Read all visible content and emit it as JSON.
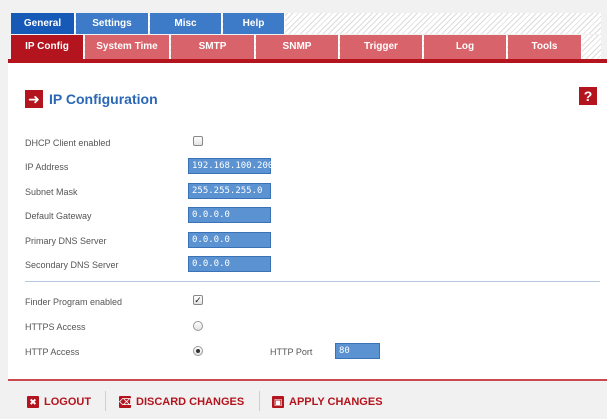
{
  "main_tabs": [
    {
      "label": "General",
      "active": true
    },
    {
      "label": "Settings",
      "active": false
    },
    {
      "label": "Misc",
      "active": false
    },
    {
      "label": "Help",
      "active": false
    }
  ],
  "sub_tabs": [
    {
      "label": "IP Config",
      "active": true
    },
    {
      "label": "System Time",
      "active": false
    },
    {
      "label": "SMTP",
      "active": false
    },
    {
      "label": "SNMP",
      "active": false
    },
    {
      "label": "Trigger",
      "active": false
    },
    {
      "label": "Log",
      "active": false
    },
    {
      "label": "Tools",
      "active": false
    }
  ],
  "panel": {
    "title": "IP Configuration",
    "title_icon": "arrow-right-icon",
    "help_icon": "help-icon"
  },
  "form": {
    "dhcp": {
      "label": "DHCP Client enabled",
      "checked": false
    },
    "ip_address": {
      "label": "IP Address",
      "value": "192.168.100.200"
    },
    "subnet_mask": {
      "label": "Subnet Mask",
      "value": "255.255.255.0"
    },
    "default_gateway": {
      "label": "Default Gateway",
      "value": "0.0.0.0"
    },
    "primary_dns": {
      "label": "Primary DNS Server",
      "value": "0.0.0.0"
    },
    "secondary_dns": {
      "label": "Secondary DNS Server",
      "value": "0.0.0.0"
    },
    "finder": {
      "label": "Finder Program enabled",
      "checked": true
    },
    "https": {
      "label": "HTTPS Access",
      "selected": false
    },
    "http": {
      "label": "HTTP Access",
      "selected": true
    },
    "http_port": {
      "label": "HTTP Port",
      "value": "80"
    }
  },
  "actions": {
    "logout": "LOGOUT",
    "discard": "DISCARD CHANGES",
    "apply": "APPLY CHANGES"
  },
  "colors": {
    "accent_red": "#b3141d",
    "tab_blue": "#1659b6",
    "field_blue": "#5b92d1",
    "title_blue": "#2a67b4"
  }
}
